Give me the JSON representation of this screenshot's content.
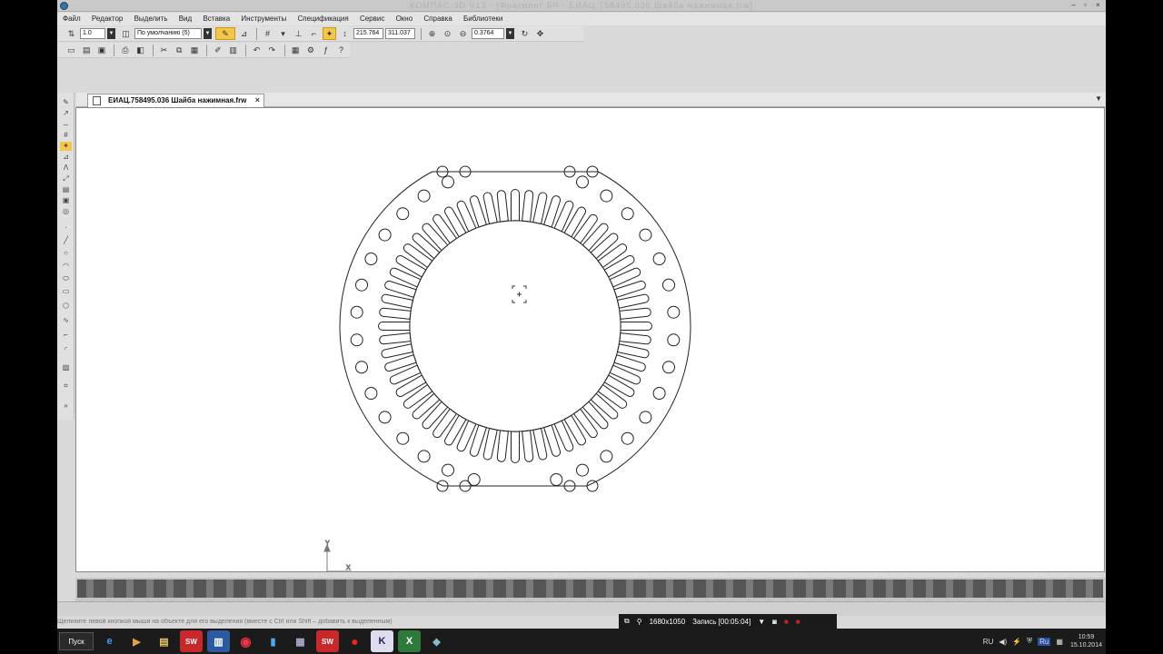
{
  "window": {
    "title": "КОМПАС-3D V13 - [Фрагмент БЧ - ЕИАЦ.758495.036 Шайба нажимная.frw]",
    "controls": [
      "–",
      "▫",
      "×"
    ]
  },
  "menu": [
    "Файл",
    "Редактор",
    "Выделить",
    "Вид",
    "Вставка",
    "Инструменты",
    "Спецификация",
    "Сервис",
    "Окно",
    "Справка",
    "Библиотеки"
  ],
  "toolbar1": {
    "scale_value": "1.0",
    "style_value": "По умолчанию (5)",
    "coord_x": "215.764",
    "coord_y": "311.037",
    "zoom_value": "0.3764"
  },
  "document": {
    "tab_title": "ЕИАЦ.758495.036 Шайба нажимная.frw",
    "close": "×",
    "tab_menu": "▼"
  },
  "origin_axes": {
    "y": "Y",
    "x": "X"
  },
  "status_hint": "Щелкните левой кнопкой мыши на объекте для его выделения (вместе с Ctrl или Shift – добавить к выделенным)",
  "recorder": {
    "resolution": "1680x1050",
    "recording": "Запись [00:05:04]"
  },
  "taskbar": {
    "start_label": "Пуск",
    "apps": [
      "ie-icon",
      "media-icon",
      "explorer-icon",
      "solidworks-icon",
      "winword-icon",
      "chrome-icon",
      "usb-icon",
      "calculator-icon",
      "solidworks2-icon",
      "recorder-icon",
      "kompas-icon",
      "excel-icon",
      "network-icon"
    ],
    "lang": "RU",
    "lang_badge": "Ru",
    "time": "10:59",
    "date": "15.10.2014"
  },
  "colors": {
    "accent_yellow": "#f3c64a",
    "canvas_bg": "#ffffff",
    "drawing_line": "#222222"
  }
}
